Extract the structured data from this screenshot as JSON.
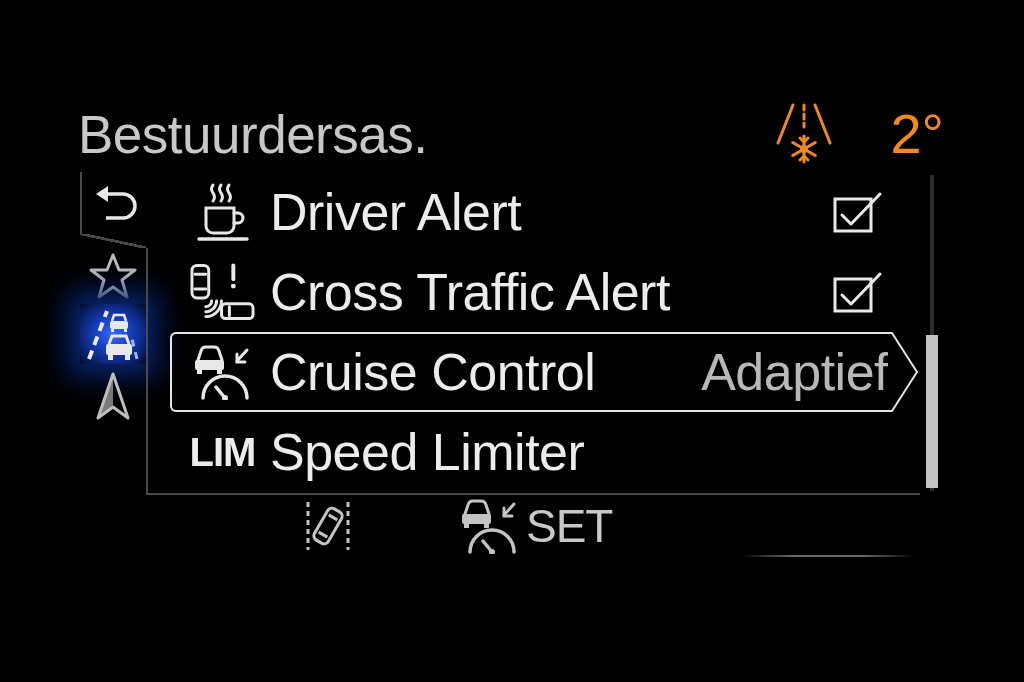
{
  "header": {
    "title": "Bestuurdersas.",
    "temperature": "2°"
  },
  "sidebar": {
    "items": [
      {
        "selected": false
      },
      {
        "selected": true
      },
      {
        "selected": false
      }
    ]
  },
  "menu": {
    "items": [
      {
        "kind": "checkbox",
        "label": "Driver Alert",
        "checked": true,
        "selected": false
      },
      {
        "kind": "checkbox",
        "label": "Cross Traffic Alert",
        "checked": true,
        "selected": false
      },
      {
        "kind": "value",
        "label": "Cruise Control",
        "value": "Adaptief",
        "selected": true
      },
      {
        "kind": "plain",
        "prefix": "LIM",
        "label": "Speed Limiter",
        "selected": false
      }
    ]
  },
  "status_bar": {
    "cruise_status": "SET"
  }
}
